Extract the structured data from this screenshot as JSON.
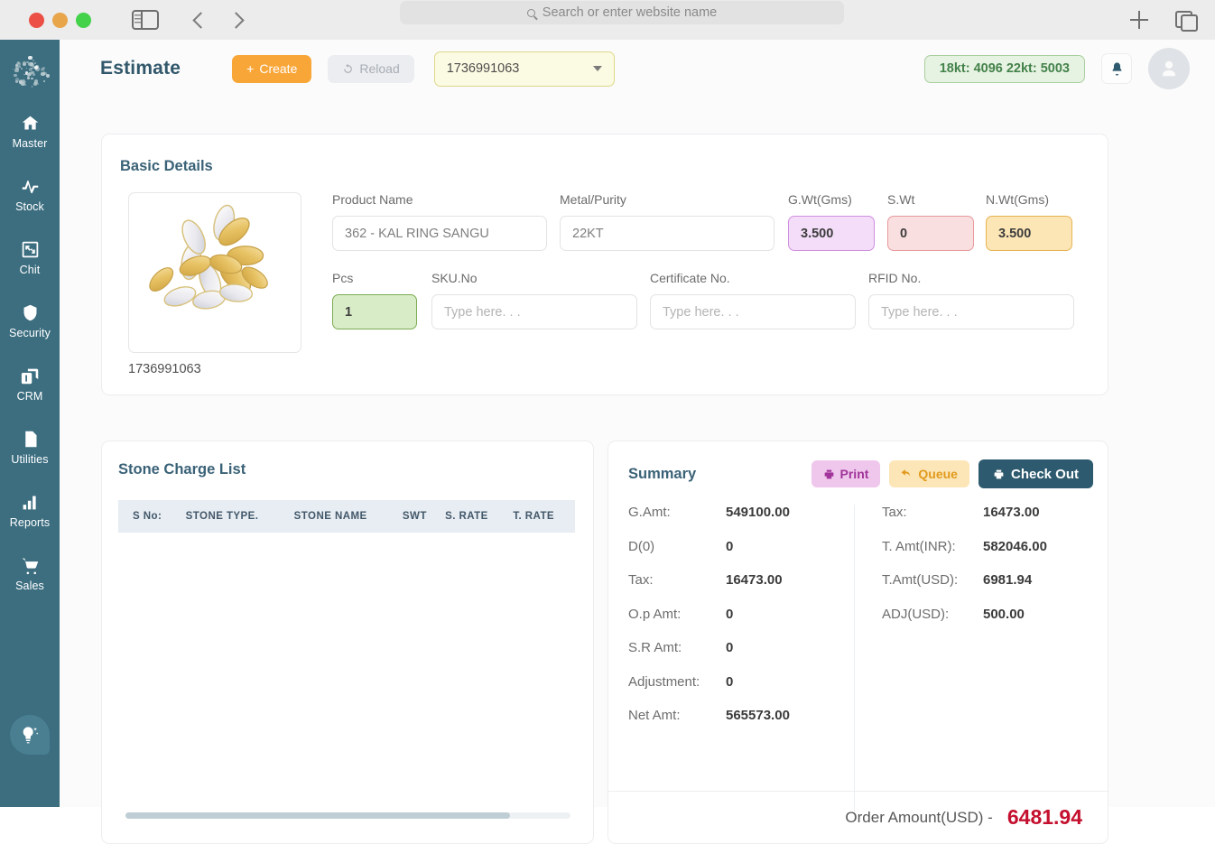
{
  "browser": {
    "url_placeholder": "Search or enter website name",
    "icons": {
      "sidebar_toggle": "sidebar-toggle-icon",
      "back": "chevron-left-icon",
      "forward": "chevron-right-icon",
      "search": "search-icon",
      "new_tab": "plus-icon",
      "tab_overview": "tabs-icon"
    }
  },
  "sidebar": {
    "logo": "brand-logo",
    "items": [
      {
        "label": "Master",
        "icon": "home-icon"
      },
      {
        "label": "Stock",
        "icon": "pulse-icon"
      },
      {
        "label": "Chit",
        "icon": "frame-icon"
      },
      {
        "label": "Security",
        "icon": "shield-icon"
      },
      {
        "label": "CRM",
        "icon": "cards-icon"
      },
      {
        "label": "Utilities",
        "icon": "sim-icon"
      },
      {
        "label": "Reports",
        "icon": "bar-chart-icon"
      },
      {
        "label": "Sales",
        "icon": "cart-icon"
      }
    ],
    "help_fab": "lightbulb-icon"
  },
  "header": {
    "title": "Estimate",
    "create_label": "Create",
    "reload_label": "Reload",
    "estimate_no": "1736991063",
    "rate_badge": "18kt: 4096 22kt: 5003",
    "notification_icon": "bell-icon",
    "avatar_icon": "user-icon"
  },
  "basic_details": {
    "title": "Basic Details",
    "product_code": "1736991063",
    "fields": {
      "product_name": {
        "label": "Product Name",
        "value": "362 - KAL RING SANGU"
      },
      "metal_purity": {
        "label": "Metal/Purity",
        "value": "22KT"
      },
      "gwt": {
        "label": "G.Wt(Gms)",
        "value": "3.500"
      },
      "swt": {
        "label": "S.Wt",
        "value": "0"
      },
      "nwt": {
        "label": "N.Wt(Gms)",
        "value": "3.500"
      },
      "pcs": {
        "label": "Pcs",
        "value": "1"
      },
      "sku_no": {
        "label": "SKU.No",
        "placeholder": "Type here. . ."
      },
      "certificate_no": {
        "label": "Certificate No.",
        "placeholder": "Type here. . ."
      },
      "rfid_no": {
        "label": "RFID No.",
        "placeholder": "Type here. . ."
      }
    }
  },
  "stone_charge_list": {
    "title": "Stone Charge List",
    "columns": [
      "S No:",
      "STONE TYPE.",
      "STONE NAME",
      "SWT",
      "S. RATE",
      "T. RATE"
    ],
    "rows": []
  },
  "summary": {
    "title": "Summary",
    "buttons": {
      "print": "Print",
      "queue": "Queue",
      "checkout": "Check Out"
    },
    "left": [
      {
        "key": "G.Amt:",
        "value": "549100.00"
      },
      {
        "key": "D(0)",
        "value": "0"
      },
      {
        "key": "Tax:",
        "value": "16473.00"
      },
      {
        "key": "O.p Amt:",
        "value": "0"
      },
      {
        "key": "S.R Amt:",
        "value": "0"
      },
      {
        "key": "Adjustment:",
        "value": "0"
      },
      {
        "key": "Net Amt:",
        "value": "565573.00"
      }
    ],
    "right": [
      {
        "key": "Tax:",
        "value": "16473.00"
      },
      {
        "key": "T. Amt(INR):",
        "value": "582046.00"
      },
      {
        "key": "T.Amt(USD):",
        "value": "6981.94"
      },
      {
        "key": "ADJ(USD):",
        "value": "500.00"
      }
    ],
    "order": {
      "label": "Order Amount(USD) -",
      "amount": "6481.94"
    }
  }
}
